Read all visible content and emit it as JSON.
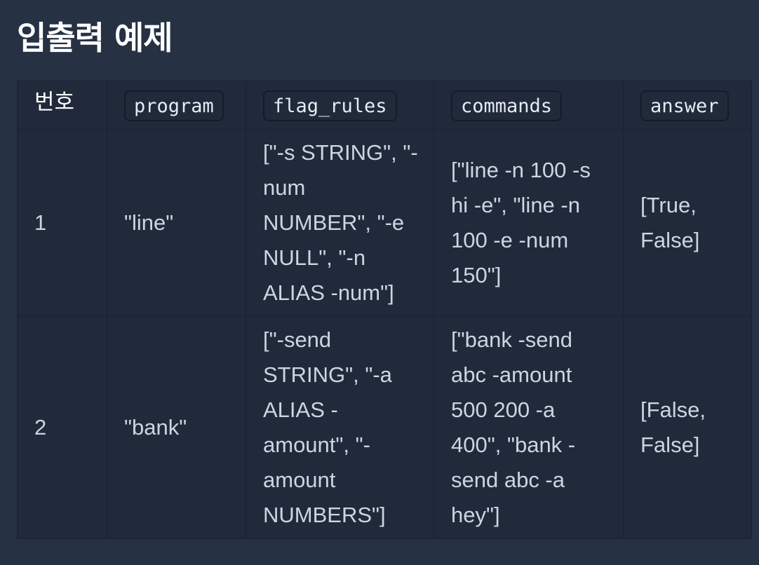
{
  "page": {
    "title": "입출력 예제"
  },
  "table": {
    "headers": [
      "번호",
      "program",
      "flag_rules",
      "commands",
      "answer"
    ],
    "rows": [
      {
        "number": "1",
        "program": "\"line\"",
        "flag_rules": "[\"-s STRING\", \"-num NUMBER\", \"-e NULL\", \"-n ALIAS -num\"]",
        "commands": "[\"line -n 100 -s hi -e\", \"line -n 100 -e -num 150\"]",
        "answer": "[True, False]"
      },
      {
        "number": "2",
        "program": "\"bank\"",
        "flag_rules": "[\"-send STRING\", \"-a ALIAS -amount\", \"-amount NUMBERS\"]",
        "commands": "[\"bank -send abc -amount 500 200 -a 400\", \"bank -send abc -a hey\"]",
        "answer": "[False, False]"
      }
    ]
  }
}
